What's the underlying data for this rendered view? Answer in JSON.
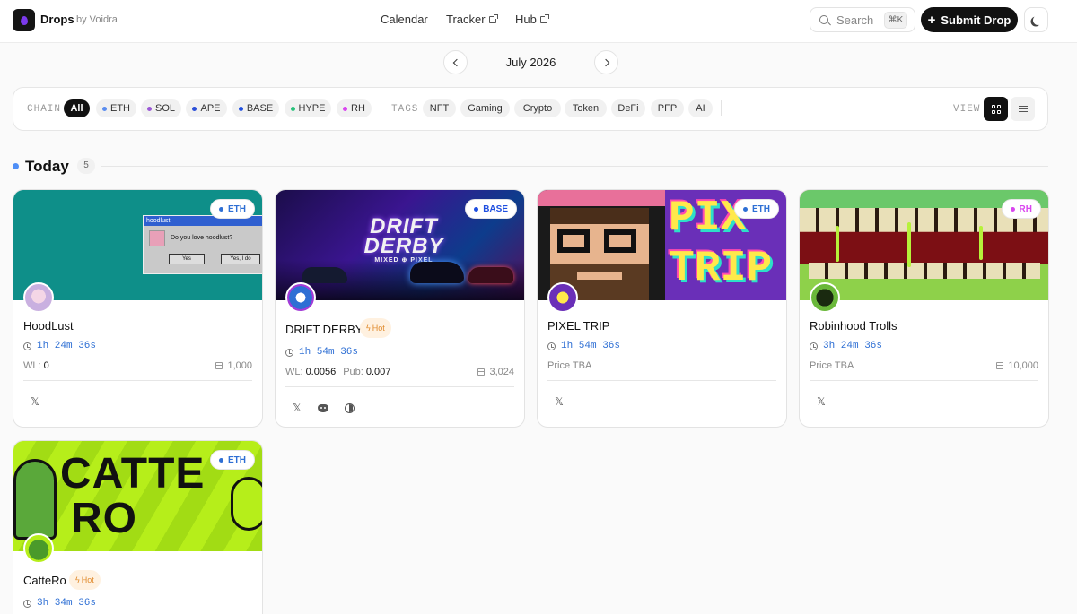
{
  "header": {
    "brand": "Drops",
    "byline": "by Voidra",
    "nav": [
      {
        "label": "Calendar",
        "external": false
      },
      {
        "label": "Tracker",
        "external": true
      },
      {
        "label": "Hub",
        "external": true
      }
    ],
    "search": {
      "placeholder": "Search",
      "shortcut": "⌘K"
    },
    "submit_label": "Submit Drop",
    "theme_icon": "moon-icon"
  },
  "month_nav": {
    "label": "July 2026"
  },
  "filters": {
    "chain_label": "CHAIN",
    "chains": [
      {
        "label": "All",
        "active": true,
        "color": ""
      },
      {
        "label": "ETH",
        "active": false,
        "color": "#5b8def"
      },
      {
        "label": "SOL",
        "active": false,
        "color": "#9b59d6"
      },
      {
        "label": "APE",
        "active": false,
        "color": "#2b4fd8"
      },
      {
        "label": "BASE",
        "active": false,
        "color": "#1f4fe0"
      },
      {
        "label": "HYPE",
        "active": false,
        "color": "#27c17a"
      },
      {
        "label": "RH",
        "active": false,
        "color": "#d946ef"
      }
    ],
    "tags_label": "TAGS",
    "tags": [
      "NFT",
      "Gaming",
      "Crypto",
      "Token",
      "DeFi",
      "PFP",
      "AI"
    ],
    "view_label": "VIEW",
    "view_mode": "grid"
  },
  "section": {
    "title": "Today",
    "count": "5"
  },
  "cards": [
    {
      "name": "HoodLust",
      "chain": "ETH",
      "chain_color": "#2e6fd4",
      "hot": false,
      "hot_label": "",
      "timer": "1h 24m 36s",
      "wl_label": "WL:",
      "wl_value": "0",
      "pub_label": "",
      "pub_value": "",
      "price_text": "",
      "supply": "1,000",
      "socials": [
        "x-icon"
      ],
      "popup": {
        "title": "hoodlust",
        "question": "Do you love hoodlust?",
        "yes": "Yes",
        "yes2": "Yes, I do"
      }
    },
    {
      "name": "DRIFT DERBY",
      "chain": "BASE",
      "chain_color": "#1f4fe0",
      "hot": true,
      "hot_label": "Hot",
      "timer": "1h 54m 36s",
      "wl_label": "WL:",
      "wl_value": "0.0056",
      "pub_label": "Pub:",
      "pub_value": "0.007",
      "price_text": "",
      "supply": "3,024",
      "socials": [
        "x-icon",
        "discord-icon",
        "website-icon"
      ],
      "banner_text": {
        "line1": "DRIFT",
        "line2": "DERBY",
        "line3": "MIXED ⊕ PIXEL"
      }
    },
    {
      "name": "PIXEL TRIP",
      "chain": "ETH",
      "chain_color": "#2e6fd4",
      "hot": false,
      "hot_label": "",
      "timer": "1h 54m 36s",
      "wl_label": "",
      "wl_value": "",
      "pub_label": "",
      "pub_value": "",
      "price_text": "Price TBA",
      "supply": "",
      "socials": [
        "x-icon"
      ],
      "banner_text": {
        "line1": "PIX",
        "line2": "TRIP"
      }
    },
    {
      "name": "Robinhood Trolls",
      "chain": "RH",
      "chain_color": "#d946ef",
      "hot": false,
      "hot_label": "",
      "timer": "3h 24m 36s",
      "wl_label": "",
      "wl_value": "",
      "pub_label": "",
      "pub_value": "",
      "price_text": "Price TBA",
      "supply": "10,000",
      "socials": [
        "x-icon"
      ]
    },
    {
      "name": "CatteRo",
      "chain": "ETH",
      "chain_color": "#2e6fd4",
      "hot": true,
      "hot_label": "Hot",
      "timer": "3h 34m 36s",
      "wl_label": "",
      "wl_value": "",
      "pub_label": "",
      "pub_value": "",
      "price_text": "",
      "supply": "",
      "socials": [],
      "banner_text": {
        "line1": "CATTE",
        "line2": "RO"
      }
    }
  ]
}
